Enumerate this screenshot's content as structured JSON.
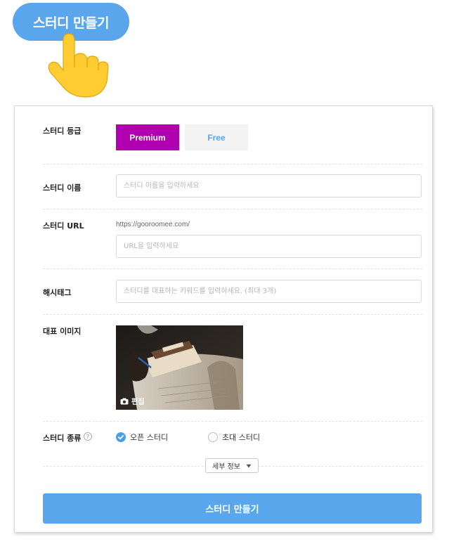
{
  "hero": {
    "button_label": "스터디 만들기",
    "pointer_icon": "pointing-hand-icon"
  },
  "form": {
    "grade": {
      "label": "스터디 등급",
      "options": [
        "Premium",
        "Free"
      ],
      "selected": "Premium"
    },
    "name": {
      "label": "스터디 이름",
      "placeholder": "스터디 이름을 입력하세요"
    },
    "url": {
      "label": "스터디 URL",
      "prefix": "https://gooroomee.com/",
      "placeholder": "URL을 입력하세요"
    },
    "hashtag": {
      "label": "해시태그",
      "placeholder": "스터디를 대표하는 키워드를 입력하세요. (최대 3개)"
    },
    "image": {
      "label": "대표 이미지",
      "edit_label": "편집",
      "edit_icon": "camera-icon"
    },
    "type": {
      "label": "스터디 종류",
      "help_icon": "question-icon",
      "options": [
        "오픈 스터디",
        "초대 스터디"
      ],
      "selected": "오픈 스터디"
    },
    "detail_toggle": "세부 정보",
    "submit_label": "스터디 만들기"
  },
  "colors": {
    "accent_blue": "#5aa6ec",
    "premium_purple": "#b000b0",
    "radio_checked": "#4a9ee8"
  }
}
